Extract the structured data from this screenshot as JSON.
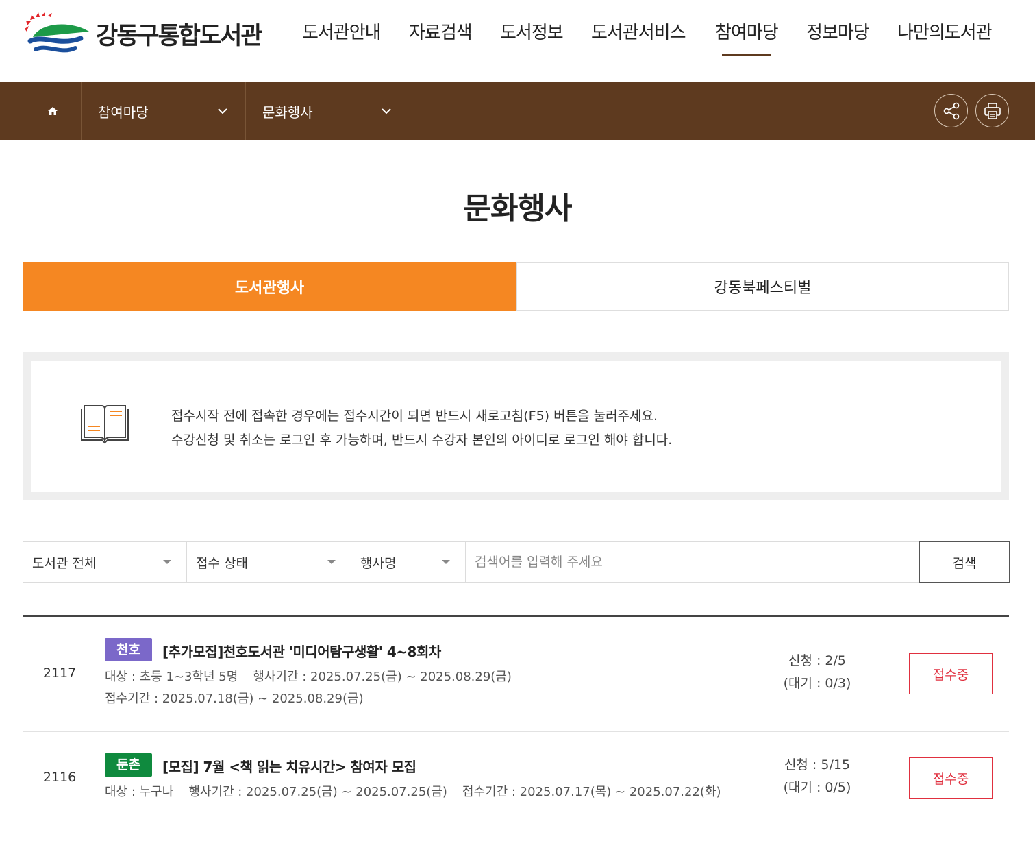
{
  "header": {
    "logo_text": "강동구통합도서관",
    "nav": [
      "도서관안내",
      "자료검색",
      "도서정보",
      "도서관서비스",
      "참여마당",
      "정보마당",
      "나만의도서관"
    ],
    "active_nav": "참여마당"
  },
  "location": {
    "home_icon": "home-icon",
    "depth1": "참여마당",
    "depth2": "문화행사",
    "share_icon": "share-icon",
    "print_icon": "print-icon"
  },
  "page": {
    "title": "문화행사"
  },
  "tabs": [
    {
      "label": "도서관행사",
      "active": true
    },
    {
      "label": "강동북페스티벌",
      "active": false
    }
  ],
  "notice": {
    "icon": "book-icon",
    "line1": "접수시작 전에 접속한 경우에는 접수시간이 되면 반드시 새로고침(F5) 버튼을 눌러주세요.",
    "line2": "수강신청 및 취소는 로그인 후 가능하며, 반드시 수강자 본인의 아이디로 로그인 해야 합니다."
  },
  "search": {
    "library_select": "도서관 전체",
    "status_select": "접수 상태",
    "field_select": "행사명",
    "placeholder": "검색어를 입력해 주세요",
    "value": "",
    "button": "검색"
  },
  "events": [
    {
      "no": "2117",
      "library": "천호",
      "library_color": "#7b68c9",
      "title": "[추가모집]천호도서관 '미디어탐구생활' 4~8회차",
      "target": "대상 : 초등 1~3학년 5명",
      "period": "행사기간 : 2025.07.25(금) ~ 2025.08.29(금)",
      "reception": "접수기간 : 2025.07.18(금) ~ 2025.08.29(금)",
      "applied": "신청 : 2/5",
      "waiting": "(대기 : 0/3)",
      "status": "접수중"
    },
    {
      "no": "2116",
      "library": "둔촌",
      "library_color": "#0f8a3e",
      "title": "[모집] 7월 <책 읽는 치유시간> 참여자 모집",
      "target": "대상 : 누구나",
      "period": "행사기간 : 2025.07.25(금) ~ 2025.07.25(금)",
      "reception": "접수기간 : 2025.07.17(목) ~ 2025.07.22(화)",
      "applied": "신청 : 5/15",
      "waiting": "(대기 : 0/5)",
      "status": "접수중"
    }
  ],
  "colors": {
    "brown": "#5e3a1f",
    "orange": "#f58722",
    "status_red": "#e0303f"
  }
}
